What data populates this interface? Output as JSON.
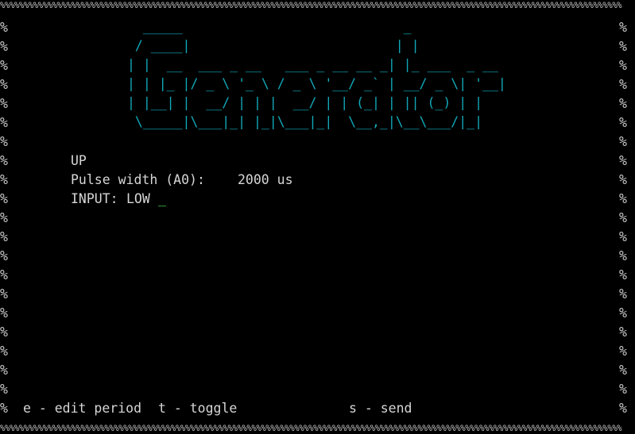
{
  "terminal": {
    "border_top": "%%%%%%%%%%%%%%%%%%%%%%%%%%%%%%%%%%%%%%%%%%%%%%%%%%%%%%%%%%%%%%%%%%%%%%%%%%%%%%%%%%%%%%%%%%%%%%%%%%%%%%%%%%%%%%%%%%%%%%%%%%%%%%%%%%%",
    "border_bottom": "%%%%%%%%%%%%%%%%%%%%%%%%%%%%%%%%%%%%%%%%%%%%%%%%%%%%%%%%%%%%%%%%%%%%%%%%%%%%%%%%%%%%%%%%%%%%%%%%%%%%%%%%%%%%%%%%%%%%%%%%%%%%%%%%%%%",
    "side_char": "%",
    "banner": "  _____                            _             \n / ____|                          | |            \n| |  __  ___ _ __   ___ _ __ __ _| |_ ___  _ __ \n| | |_ |/ _ \\ '_ \\ / _ \\ '__/ _` | __/ _ \\| '__|\n| |__| |  __/ | | |  __/ | | (_| | || (_) | |   \n \\_____|\\___|_| |_|\\___|_|  \\__,_|\\__\\___/|_|   ",
    "banner_color": "#11a8b8",
    "state": "UP",
    "pulse_label": "Pulse width (A0):",
    "pulse_value": "2000 us",
    "input_label": "INPUT:",
    "input_value": "LOW",
    "cursor": "_",
    "cursor_color": "#4ce24c",
    "shortcuts": {
      "edit": "e - edit period",
      "toggle": "t - toggle",
      "send": "s - send"
    }
  }
}
